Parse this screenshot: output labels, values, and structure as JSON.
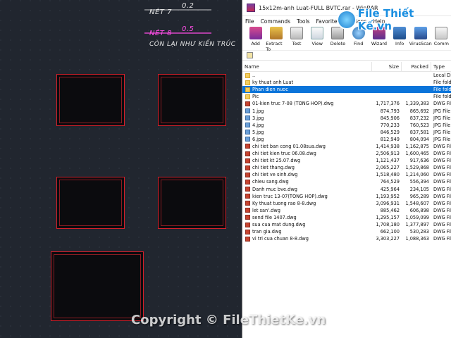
{
  "cad": {
    "label_net7": "NÉT 7",
    "label_net7_value": "0.2",
    "label_net8": "NÉT 8",
    "label_net8_value": "0.5",
    "label_remaining": "CÒN LẠI NHƯ KIẾN TRÚC",
    "line_colors": [
      "#ffffff",
      "#ff4de8"
    ],
    "sheet_border_color": "#d41f2a"
  },
  "window": {
    "title": "15x12m-anh Luat-FULL BVTC.rar - WinRAR"
  },
  "menu": [
    "File",
    "Commands",
    "Tools",
    "Favorites",
    "Options",
    "Help"
  ],
  "toolbar": [
    {
      "label": "Add",
      "icon": "add-icon"
    },
    {
      "label": "Extract To",
      "icon": "extract-icon"
    },
    {
      "label": "Test",
      "icon": "test-icon"
    },
    {
      "label": "View",
      "icon": "view-icon"
    },
    {
      "label": "Delete",
      "icon": "delete-icon"
    },
    {
      "label": "Find",
      "icon": "find-icon"
    },
    {
      "label": "Wizard",
      "icon": "wizard-icon"
    },
    {
      "label": "Info",
      "icon": "info-icon"
    },
    {
      "label": "VirusScan",
      "icon": "virusscan-icon"
    },
    {
      "label": "Comm",
      "icon": "comment-icon"
    }
  ],
  "columns": {
    "name": "Name",
    "size": "Size",
    "packed": "Packed",
    "type": "Type"
  },
  "selected_index": 2,
  "files": [
    {
      "name": "..",
      "size": "",
      "packed": "",
      "type": "Local Disk",
      "kind": "folder"
    },
    {
      "name": "ky thuat anh Luat",
      "size": "",
      "packed": "",
      "type": "File folder",
      "kind": "folder"
    },
    {
      "name": "Phan dien nuoc",
      "size": "",
      "packed": "",
      "type": "File folder",
      "kind": "folder"
    },
    {
      "name": "Pic",
      "size": "",
      "packed": "",
      "type": "File folder",
      "kind": "folder"
    },
    {
      "name": "01-kien truc 7-08 (TONG HOP).dwg",
      "size": "1,717,376",
      "packed": "1,339,383",
      "type": "DWG File",
      "kind": "dwg"
    },
    {
      "name": "1.jpg",
      "size": "874,793",
      "packed": "865,692",
      "type": "JPG File",
      "kind": "jpg"
    },
    {
      "name": "3.jpg",
      "size": "845,906",
      "packed": "837,232",
      "type": "JPG File",
      "kind": "jpg"
    },
    {
      "name": "4.jpg",
      "size": "770,233",
      "packed": "760,523",
      "type": "JPG File",
      "kind": "jpg"
    },
    {
      "name": "5.jpg",
      "size": "846,529",
      "packed": "837,581",
      "type": "JPG File",
      "kind": "jpg"
    },
    {
      "name": "6.jpg",
      "size": "812,949",
      "packed": "804,094",
      "type": "JPG File",
      "kind": "jpg"
    },
    {
      "name": "chi tiet ban cong 01.08sua.dwg",
      "size": "1,414,938",
      "packed": "1,162,875",
      "type": "DWG File",
      "kind": "dwg"
    },
    {
      "name": "chi tiet kien truc 06.08.dwg",
      "size": "2,506,913",
      "packed": "1,600,465",
      "type": "DWG File",
      "kind": "dwg"
    },
    {
      "name": "chi tiet kt 25.07.dwg",
      "size": "1,121,437",
      "packed": "917,636",
      "type": "DWG File",
      "kind": "dwg"
    },
    {
      "name": "chi tiet thang.dwg",
      "size": "2,065,227",
      "packed": "1,529,868",
      "type": "DWG File",
      "kind": "dwg"
    },
    {
      "name": "chi tiet ve sinh.dwg",
      "size": "1,518,480",
      "packed": "1,214,060",
      "type": "DWG File",
      "kind": "dwg"
    },
    {
      "name": "chieu sang.dwg",
      "size": "764,529",
      "packed": "556,394",
      "type": "DWG File",
      "kind": "dwg"
    },
    {
      "name": "Danh muc bve.dwg",
      "size": "425,964",
      "packed": "234,105",
      "type": "DWG File",
      "kind": "dwg"
    },
    {
      "name": "kien truc 13-07(TONG HOP).dwg",
      "size": "1,193,952",
      "packed": "965,289",
      "type": "DWG File",
      "kind": "dwg"
    },
    {
      "name": "Ky thuat tuong rao 8-8.dwg",
      "size": "3,096,931",
      "packed": "1,548,607",
      "type": "DWG File",
      "kind": "dwg"
    },
    {
      "name": "let san'.dwg",
      "size": "885,462",
      "packed": "606,898",
      "type": "DWG File",
      "kind": "dwg"
    },
    {
      "name": "send file 1407.dwg",
      "size": "1,295,157",
      "packed": "1,059,099",
      "type": "DWG File",
      "kind": "dwg"
    },
    {
      "name": "sua cua mat dung.dwg",
      "size": "1,708,180",
      "packed": "1,377,897",
      "type": "DWG File",
      "kind": "dwg"
    },
    {
      "name": "tran gia.dwg",
      "size": "662,100",
      "packed": "530,283",
      "type": "DWG File",
      "kind": "dwg"
    },
    {
      "name": "vi tri cua chuan 8-8.dwg",
      "size": "3,303,227",
      "packed": "1,088,363",
      "type": "DWG File",
      "kind": "dwg"
    }
  ],
  "overlay": {
    "logo_text": "File Thiết Kế.vn",
    "watermark": "Copyright © FileThietKe.vn"
  }
}
